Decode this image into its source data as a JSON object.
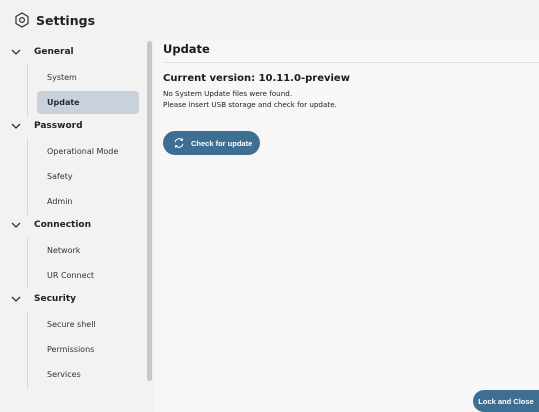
{
  "header": {
    "title": "Settings",
    "icon": "hexagon-gear-icon"
  },
  "sidebar": {
    "groups": [
      {
        "label": "General",
        "items": [
          {
            "label": "System"
          },
          {
            "label": "Update"
          }
        ]
      },
      {
        "label": "Password",
        "items": [
          {
            "label": "Operational Mode"
          },
          {
            "label": "Safety"
          },
          {
            "label": "Admin"
          }
        ]
      },
      {
        "label": "Connection",
        "items": [
          {
            "label": "Network"
          },
          {
            "label": "UR Connect"
          }
        ]
      },
      {
        "label": "Security",
        "items": [
          {
            "label": "Secure shell"
          },
          {
            "label": "Permissions"
          },
          {
            "label": "Services"
          }
        ]
      }
    ],
    "active_item": "Update"
  },
  "main": {
    "title": "Update",
    "version": "Current version: 10.11.0-preview",
    "info_line_1": "No System Update files were found.",
    "info_line_2": "Please insert USB storage and check for update.",
    "check_button_label": "Check for update"
  },
  "footer": {
    "lock_button_label": "Lock and Close"
  },
  "colors": {
    "accent": "#3e6e91",
    "active_nav_bg": "#c9d2da",
    "background": "#f2f2f2"
  }
}
